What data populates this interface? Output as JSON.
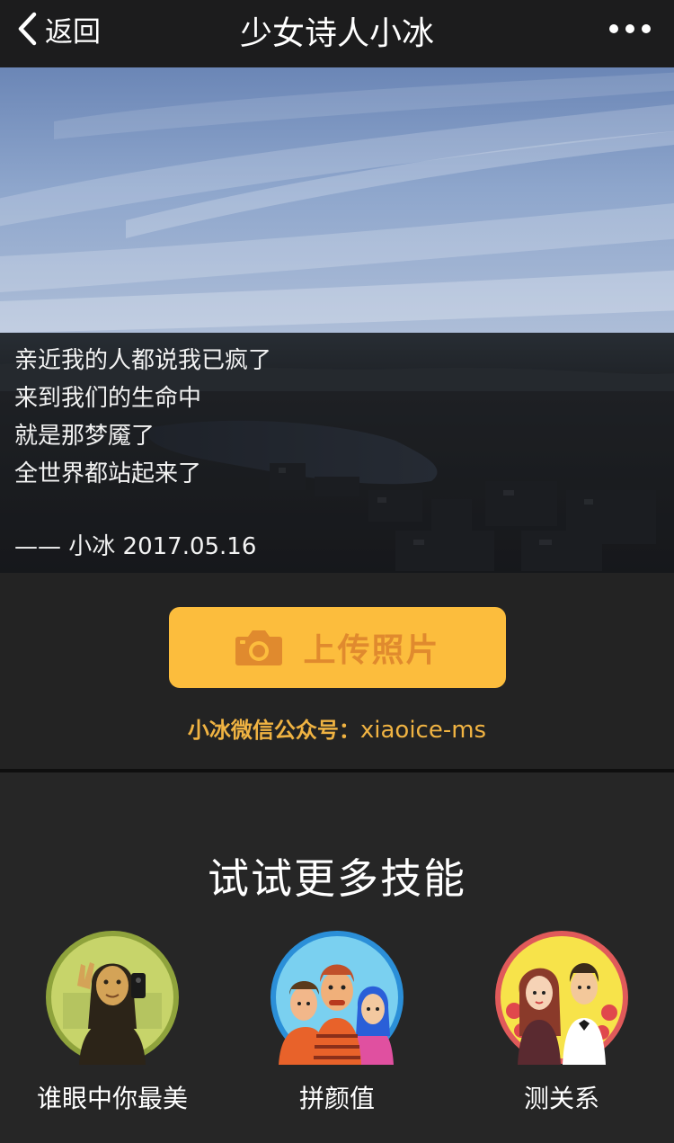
{
  "nav": {
    "back_label": "返回",
    "title": "少女诗人小冰",
    "more_icon": "more-dots-icon"
  },
  "poem": {
    "lines": [
      "亲近我的人都说我已疯了",
      "来到我们的生命中",
      "就是那梦魇了",
      "全世界都站起来了"
    ],
    "signature": "—— 小冰 2017.05.16"
  },
  "upload": {
    "label": "上传照片",
    "icon": "camera-icon",
    "wechat_key": "小冰微信公众号：",
    "wechat_value": "xiaoice-ms"
  },
  "skills": {
    "title": "试试更多技能",
    "items": [
      {
        "label": "谁眼中你最美",
        "icon": "mona-lisa-selfie-icon"
      },
      {
        "label": "拼颜值",
        "icon": "three-faces-icon"
      },
      {
        "label": "测关系",
        "icon": "couple-icon"
      }
    ]
  },
  "colors": {
    "nav_bg": "#1c1c1d",
    "upload_button": "#fcbd3d",
    "upload_text": "#e08a2e",
    "wechat_text": "#f0b342",
    "page_bg": "#232323"
  }
}
